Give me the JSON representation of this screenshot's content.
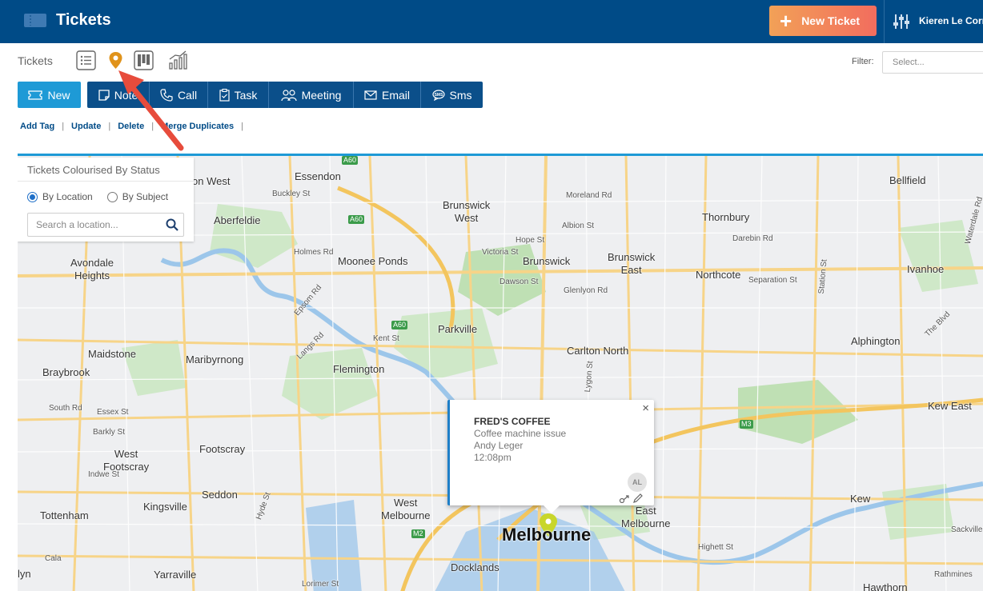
{
  "header": {
    "app_icon": "ticket-icon",
    "title": "Tickets",
    "new_ticket_label": "New Ticket",
    "user_name": "Kieren Le Corn"
  },
  "subheader": {
    "tickets_label": "Tickets",
    "view_icons": [
      "list-icon",
      "map-pin-icon",
      "kanban-icon",
      "chart-icon"
    ],
    "active_view": "map-pin-icon",
    "filter_label": "Filter:",
    "filter_placeholder": "Select..."
  },
  "actions": {
    "new": "New",
    "note": "Note",
    "call": "Call",
    "task": "Task",
    "meeting": "Meeting",
    "email": "Email",
    "sms": "Sms"
  },
  "links": {
    "add_tag": "Add Tag",
    "update": "Update",
    "delete": "Delete",
    "merge": "Merge Duplicates"
  },
  "map_panel": {
    "title": "Tickets Colourised By Status",
    "by_location": "By Location",
    "by_subject": "By Subject",
    "selected": "By Location",
    "search_placeholder": "Search a location..."
  },
  "popup": {
    "company": "FRED'S COFFEE",
    "subject": "Coffee machine issue",
    "contact": "Andy Leger",
    "time": "12:08pm",
    "avatar": "AL"
  },
  "map_labels": {
    "essendon": "Essendon",
    "on_west": "on West",
    "buckley": "Buckley St",
    "aberfeldie": "Aberfeldie",
    "holmes": "Holmes Rd",
    "moonee": "Moonee Ponds",
    "avondale1": "Avondale",
    "avondale2": "Heights",
    "epsom": "Epsom Rd",
    "brunswick_west1": "Brunswick",
    "brunswick_west2": "West",
    "moreland": "Moreland Rd",
    "albion": "Albion St",
    "hope": "Hope St",
    "victoria": "Victoria St",
    "brunswick": "Brunswick",
    "brunswick_east1": "Brunswick",
    "brunswick_east2": "East",
    "dawson": "Dawson St",
    "glenlyon": "Glenlyon Rd",
    "thornbury": "Thornbury",
    "darebin": "Darebin Rd",
    "northcote": "Northcote",
    "separation": "Separation St",
    "bellfield": "Bellfield",
    "ivanhoe": "Ivanhoe",
    "parkville": "Parkville",
    "kent": "Kent St",
    "langs": "Langs Rd",
    "maidstone": "Maidstone",
    "maribyrnong": "Maribyrnong",
    "flemington": "Flemington",
    "carlton_north": "Carlton North",
    "alphington": "Alphington",
    "braybrook": "Braybrook",
    "south_rd": "South Rd",
    "essex": "Essex St",
    "barkly": "Barkly St",
    "west_footscray1": "West",
    "west_footscray2": "Footscray",
    "indwe": "Indwe St",
    "footscray": "Footscray",
    "seddon": "Seddon",
    "kingsville": "Kingsville",
    "tottenham": "Tottenham",
    "hyde": "Hyde St",
    "yarraville": "Yarraville",
    "lyn": "lyn",
    "cala": "Cala",
    "west_melb1": "West",
    "west_melb2": "Melbourne",
    "melbourne": "Melbourne",
    "docklands": "Docklands",
    "lorimer": "Lorimer St",
    "east_melb1": "East",
    "east_melb2": "Melbourne",
    "highett": "Highett St",
    "kew_east": "Kew East",
    "kew": "Kew",
    "hawthorn": "Hawthorn",
    "rathmines": "Rathmines",
    "sackville": "Sackville",
    "lygon": "Lygon St",
    "the_blvd": "The Blvd",
    "station": "Station St",
    "waterdale": "Waterdale Rd",
    "a60": "A60",
    "m2": "M2",
    "m3": "M3"
  },
  "colors": {
    "header_bg": "#004b87",
    "accent": "#1e9ad6",
    "action_group": "#0b4f8a",
    "new_ticket_gradient": [
      "#f2a157",
      "#f26d5e"
    ],
    "map_pin": "#e0931b",
    "annotation_arrow": "#e74c3c"
  }
}
